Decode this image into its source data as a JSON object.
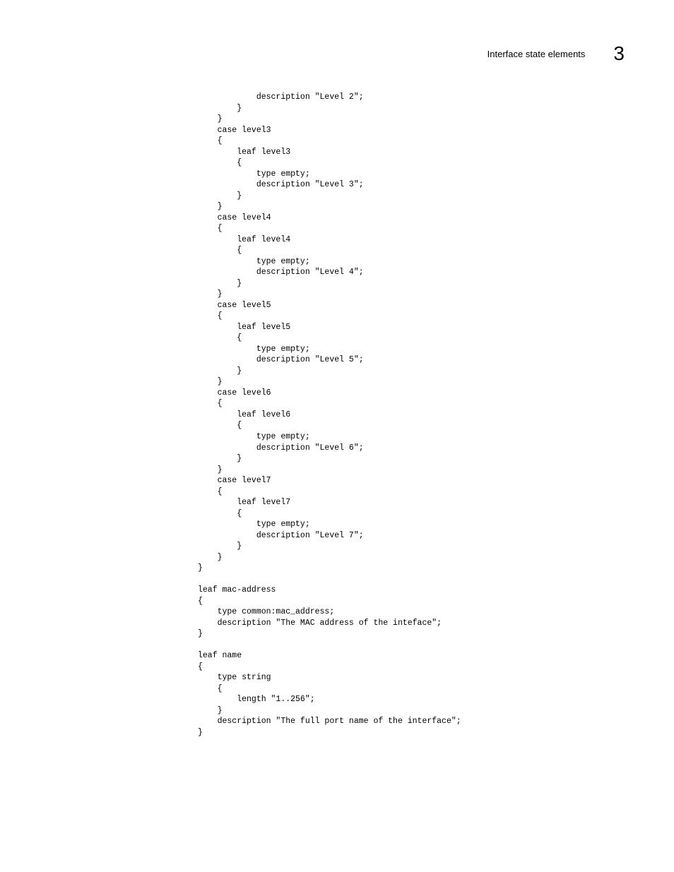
{
  "header": {
    "title": "Interface state elements",
    "chapter": "3"
  },
  "code": "            description \"Level 2\";\n        }\n    }\n    case level3\n    {\n        leaf level3\n        {\n            type empty;\n            description \"Level 3\";\n        }\n    }\n    case level4\n    {\n        leaf level4\n        {\n            type empty;\n            description \"Level 4\";\n        }\n    }\n    case level5\n    {\n        leaf level5\n        {\n            type empty;\n            description \"Level 5\";\n        }\n    }\n    case level6\n    {\n        leaf level6\n        {\n            type empty;\n            description \"Level 6\";\n        }\n    }\n    case level7\n    {\n        leaf level7\n        {\n            type empty;\n            description \"Level 7\";\n        }\n    }\n}\n\nleaf mac-address\n{\n    type common:mac_address;\n    description \"The MAC address of the inteface\";\n}\n\nleaf name\n{\n    type string\n    {\n        length \"1..256\";\n    }\n    description \"The full port name of the interface\";\n}"
}
